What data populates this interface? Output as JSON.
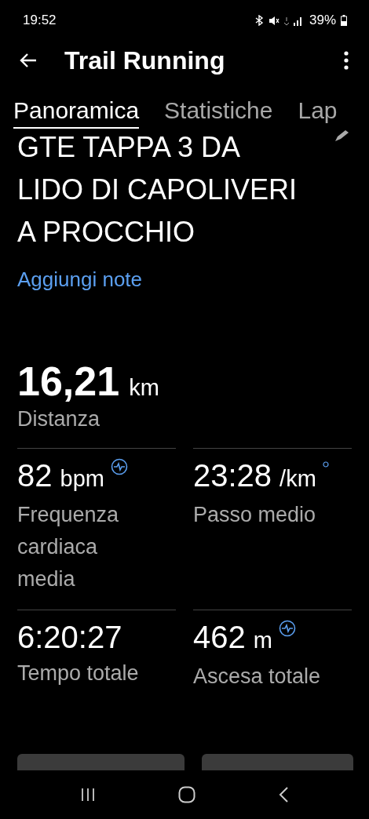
{
  "status_bar": {
    "time": "19:52",
    "battery": "39%"
  },
  "header": {
    "title": "Trail Running"
  },
  "tabs": [
    {
      "label": "Panoramica",
      "selected": true
    },
    {
      "label": "Statistiche",
      "selected": false
    },
    {
      "label": "Lap",
      "selected": false
    }
  ],
  "activity": {
    "name": "GTE TAPPA 3 DA LIDO DI CAPOLIVERI A PROCCHIO",
    "notes_link": "Aggiungi note"
  },
  "distance": {
    "value": "16,21",
    "unit": "km",
    "label": "Distanza"
  },
  "metrics": [
    {
      "value": "82",
      "unit": "bpm",
      "label": "Frequenza cardiaca media",
      "kind": "pulse"
    },
    {
      "value": "23:28",
      "unit": "/km",
      "label": "Passo medio",
      "kind": "dot"
    },
    {
      "value": "6:20:27",
      "label": "Tempo totale",
      "kind": "plain"
    },
    {
      "value": "462",
      "unit": "m",
      "label": "Ascesa totale",
      "kind": "pulse"
    }
  ]
}
